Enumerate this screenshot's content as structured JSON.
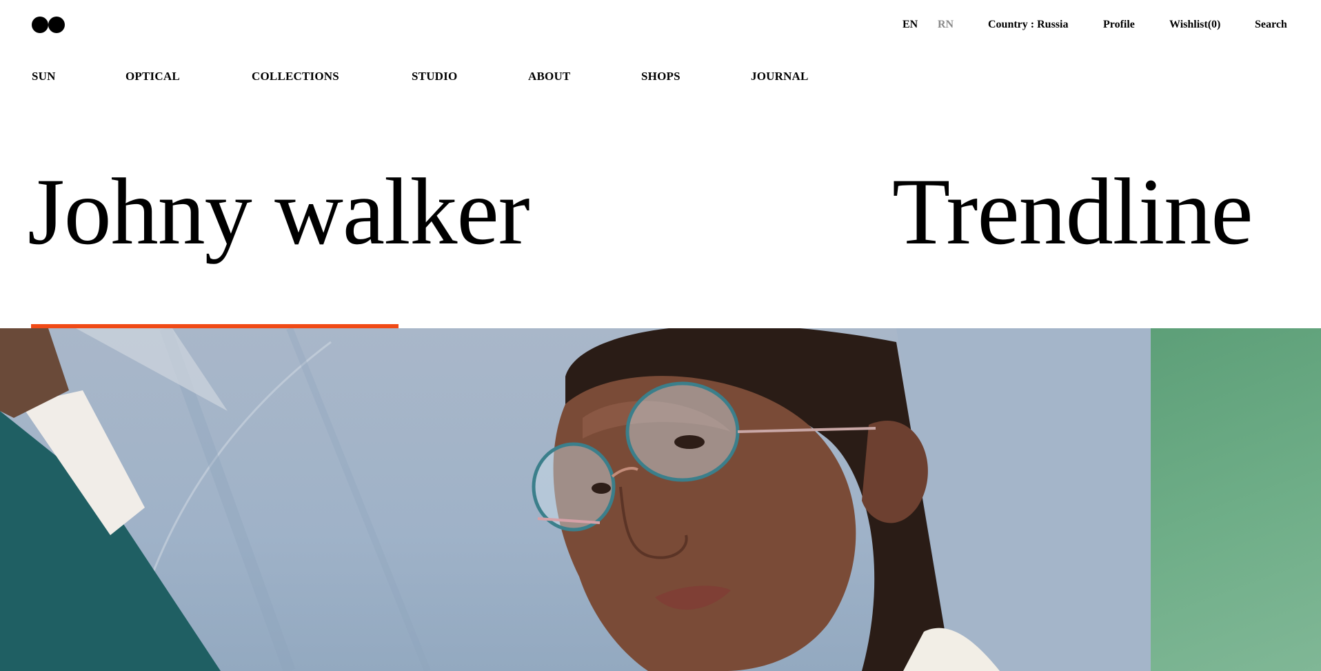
{
  "header": {
    "logo": "two-dots-logo",
    "languages": [
      {
        "code": "EN",
        "active": true
      },
      {
        "code": "RN",
        "active": false
      }
    ],
    "country_label": "Country : Russia",
    "profile_label": "Profile",
    "wishlist_label": "Wishlist(0)",
    "search_label": "Search"
  },
  "nav": {
    "items": [
      {
        "label": "SUN"
      },
      {
        "label": "OPTICAL"
      },
      {
        "label": "COLLECTIONS"
      },
      {
        "label": "STUDIO"
      },
      {
        "label": "ABOUT"
      },
      {
        "label": "SHOPS"
      },
      {
        "label": "JOURNAL"
      }
    ]
  },
  "hero": {
    "title_left": "Johny walker",
    "title_right": "Trendline",
    "slider_progress_fraction": 0.28,
    "image_subject": "woman-wearing-cat-eye-glasses",
    "accent_color": "#f04a16",
    "next_slide_color": "#6aaa84"
  }
}
